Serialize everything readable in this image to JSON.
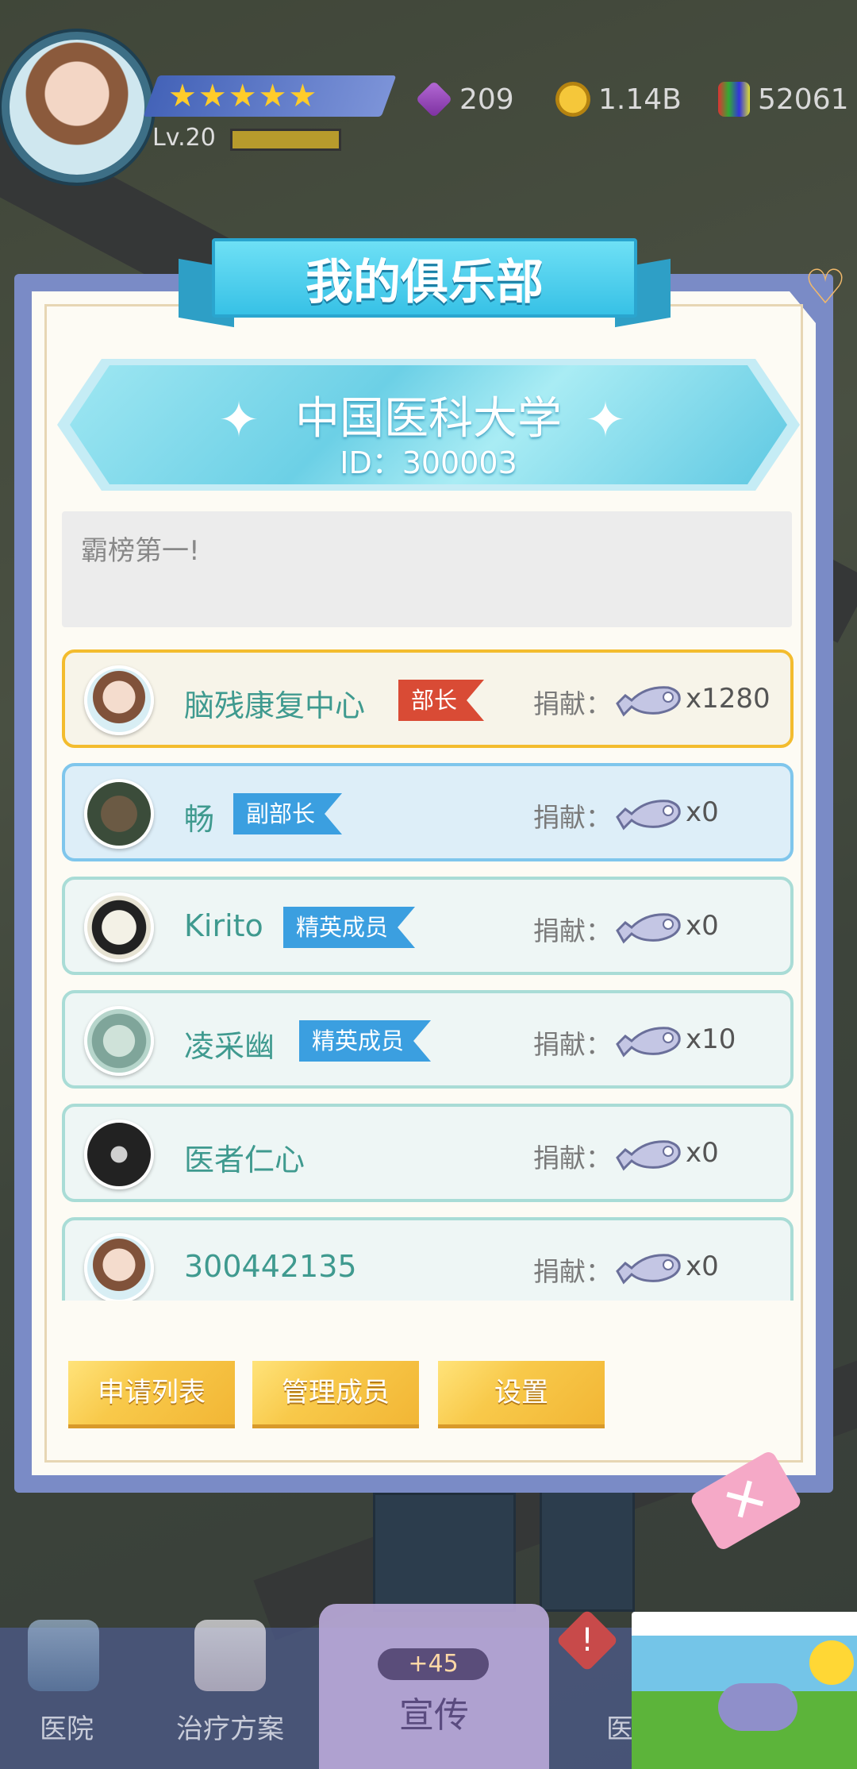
{
  "hud": {
    "stars": "★★★★★",
    "level": "Lv.20",
    "resources": {
      "gems": "209",
      "coins": "1.14B",
      "flags": "52061"
    }
  },
  "club": {
    "window_title": "我的俱乐部",
    "name": "中国医科大学",
    "id_text": "ID：300003",
    "motto": "霸榜第一!"
  },
  "members": [
    {
      "name": "脑残康复中心",
      "role": "部长",
      "contribution_label": "捐献：",
      "count": "x1280"
    },
    {
      "name": "畅",
      "role": "副部长",
      "contribution_label": "捐献：",
      "count": "x0"
    },
    {
      "name": "Kirito",
      "role": "精英成员",
      "contribution_label": "捐献：",
      "count": "x0"
    },
    {
      "name": "凌采幽",
      "role": "精英成员",
      "contribution_label": "捐献：",
      "count": "x10"
    },
    {
      "name": "医者仁心",
      "role": "",
      "contribution_label": "捐献：",
      "count": "x0"
    },
    {
      "name": "300442135",
      "role": "",
      "contribution_label": "捐献：",
      "count": "x0"
    }
  ],
  "actions": {
    "apply_list": "申请列表",
    "manage_members": "管理成员",
    "settings": "设置"
  },
  "nav": {
    "hospital": "医院",
    "treatment": "治疗方案",
    "promo": "宣传",
    "promo_bonus": "+45",
    "partial": "医"
  },
  "colors": {
    "leader_role": "#d94b35",
    "member_role": "#3b9fe0",
    "action_button": "#f8c94a",
    "title_ribbon": "#37c1e6"
  },
  "icons": [
    "gem-icon",
    "coin-icon",
    "flag-icon",
    "heart-icon",
    "fish-icon",
    "close-icon",
    "alert-icon",
    "sparkle-icon"
  ]
}
